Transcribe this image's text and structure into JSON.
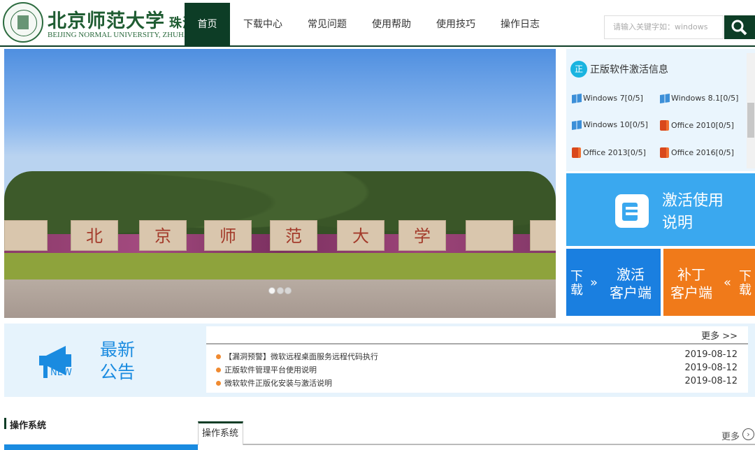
{
  "header": {
    "logo_cn": "北京师范大学",
    "logo_city": "珠海",
    "logo_en": "BEIJING NORMAL UNIVERSITY, ZHUHAI",
    "nav": [
      "首页",
      "下载中心",
      "常见问题",
      "使用帮助",
      "使用技巧",
      "操作日志"
    ],
    "search_placeholder": "请输入关键字如：windows"
  },
  "banner": {
    "stone_chars": [
      "北",
      "京",
      "师",
      "范",
      "大",
      "学"
    ],
    "active_slide": 1,
    "slide_count": 3
  },
  "activation": {
    "badge": "正",
    "title": "正版软件激活信息",
    "items": [
      {
        "icon": "windows-icon",
        "label": "Windows 7[0/5]"
      },
      {
        "icon": "windows-icon",
        "label": "Windows 8.1[0/5]"
      },
      {
        "icon": "windows-icon",
        "label": "Windows 10[0/5]"
      },
      {
        "icon": "office-icon",
        "label": "Office 2010[0/5]"
      },
      {
        "icon": "office-icon",
        "label": "Office 2013[0/5]"
      },
      {
        "icon": "office-icon",
        "label": "Office 2016[0/5]"
      }
    ]
  },
  "tiles": {
    "guide": [
      "激活使用",
      "说明"
    ],
    "client_dl": "下载",
    "client": [
      "激活",
      "客户端"
    ],
    "patch": [
      "补丁",
      "客户端"
    ],
    "patch_dl": "下载"
  },
  "notice": {
    "badge": "NEW",
    "title": [
      "最新",
      "公告"
    ],
    "more": "更多 >>",
    "items": [
      {
        "text": "【漏洞预警】微软远程桌面服务远程代码执行",
        "date": "2019-08-12"
      },
      {
        "text": "正版软件管理平台使用说明",
        "date": "2019-08-12"
      },
      {
        "text": "微软软件正版化安装与激活说明",
        "date": "2019-08-12"
      }
    ]
  },
  "section": {
    "title": "操作系统",
    "tab": "操作系统",
    "more": "更多"
  }
}
